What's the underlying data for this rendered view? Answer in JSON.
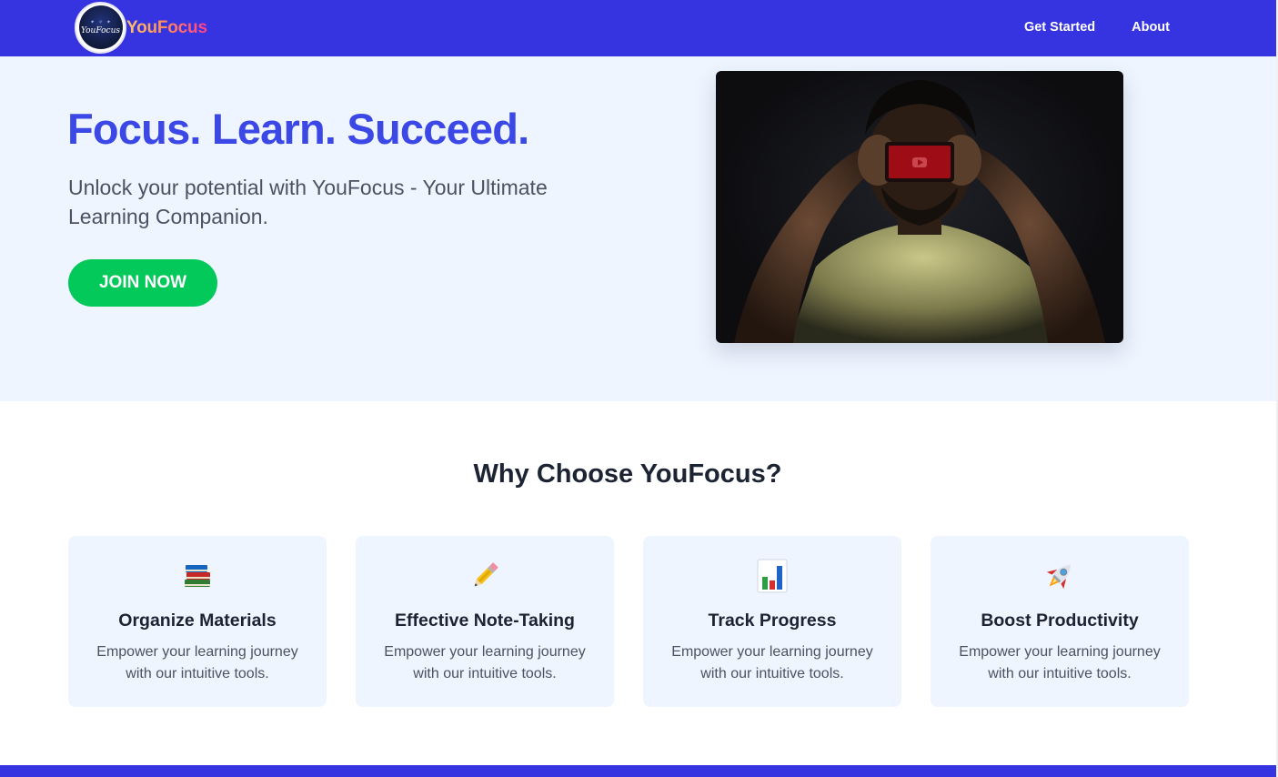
{
  "nav": {
    "brand": "YouFocus",
    "logo_text": "YouFocus",
    "links": [
      "Get Started",
      "About"
    ]
  },
  "hero": {
    "title": "Focus. Learn. Succeed.",
    "subtitle": "Unlock your potential with YouFocus - Your Ultimate Learning Companion.",
    "cta": "JOIN NOW"
  },
  "why": {
    "title": "Why Choose YouFocus?",
    "cards": [
      {
        "icon": "books-icon",
        "title": "Organize Materials",
        "desc": "Empower your learning journey with our intuitive tools."
      },
      {
        "icon": "pencil-icon",
        "title": "Effective Note-Taking",
        "desc": "Empower your learning journey with our intuitive tools."
      },
      {
        "icon": "bar-chart-icon",
        "title": "Track Progress",
        "desc": "Empower your learning journey with our intuitive tools."
      },
      {
        "icon": "rocket-icon",
        "title": "Boost Productivity",
        "desc": "Empower your learning journey with our intuitive tools."
      }
    ]
  },
  "colors": {
    "nav_bg": "#3634e0",
    "hero_bg": "#eef5ff",
    "title": "#3b48e6",
    "cta": "#03c85a"
  }
}
